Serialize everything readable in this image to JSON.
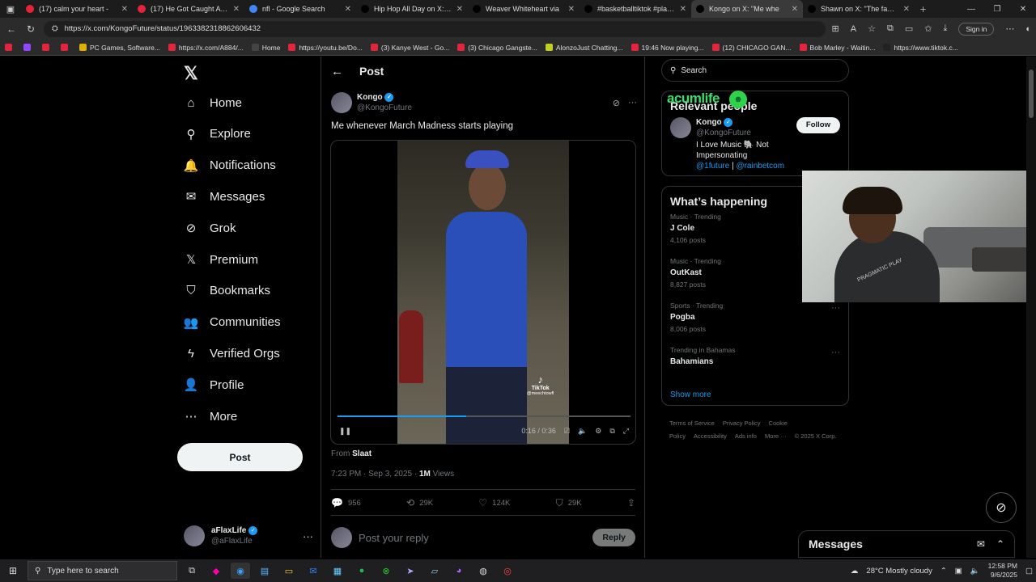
{
  "browser": {
    "tabs": [
      {
        "label": "(17) calm your heart -",
        "icon": "youtube-icon",
        "color": "#e5243b"
      },
      {
        "label": "(17) He Got Caught A 2ND",
        "icon": "youtube-icon",
        "color": "#e5243b"
      },
      {
        "label": "nfl - Google Search",
        "icon": "google-icon",
        "color": "#4285f4"
      },
      {
        "label": "Hip Hop All Day on X: \"You",
        "icon": "x-icon",
        "color": "#000000"
      },
      {
        "label": "Weaver Whiteheart via",
        "icon": "x-icon",
        "color": "#000000"
      },
      {
        "label": "#basketballtiktok #plaqueb",
        "icon": "tiktok-icon",
        "color": "#000000"
      },
      {
        "label": "Kongo on X: \"Me whe",
        "icon": "x-icon",
        "color": "#000000"
      },
      {
        "label": "Shawn on X: \"The fact nigg",
        "icon": "x-icon",
        "color": "#000000"
      }
    ],
    "url": "https://x.com/KongoFuture/status/1963382318862606432",
    "signin_label": "Sign in",
    "bookmarks": [
      {
        "label": "",
        "color": "#e5243b"
      },
      {
        "label": "",
        "color": "#9146ff"
      },
      {
        "label": "",
        "color": "#e5243b"
      },
      {
        "label": "",
        "color": "#e5243b"
      },
      {
        "label": "PC Games, Software...",
        "color": "#e0b000"
      },
      {
        "label": "https://x.com/A884/...",
        "color": "#e5243b"
      },
      {
        "label": "Home",
        "color": "#444444"
      },
      {
        "label": "https://youtu.be/Do...",
        "color": "#e5243b"
      },
      {
        "label": "(3) Kanye West - Go...",
        "color": "#e5243b"
      },
      {
        "label": "(3) Chicago Gangste...",
        "color": "#e5243b"
      },
      {
        "label": "AlonzoJust Chatting...",
        "color": "#c0d020"
      },
      {
        "label": "19:46 Now playing...",
        "color": "#e5243b"
      },
      {
        "label": "(12) CHICAGO GAN...",
        "color": "#e5243b"
      },
      {
        "label": "Bob Marley - Waitin...",
        "color": "#e5243b"
      },
      {
        "label": "https://www.tiktok.c...",
        "color": "#222222"
      }
    ]
  },
  "nav": {
    "items": [
      {
        "label": "Home",
        "icon": "home-icon",
        "glyph": "⌂"
      },
      {
        "label": "Explore",
        "icon": "search-icon",
        "glyph": "⚲"
      },
      {
        "label": "Notifications",
        "icon": "bell-icon",
        "glyph": "🔔"
      },
      {
        "label": "Messages",
        "icon": "envelope-icon",
        "glyph": "✉"
      },
      {
        "label": "Grok",
        "icon": "grok-icon",
        "glyph": "⊘"
      },
      {
        "label": "Premium",
        "icon": "x-icon",
        "glyph": "𝕏"
      },
      {
        "label": "Bookmarks",
        "icon": "bookmark-icon",
        "glyph": "⛉"
      },
      {
        "label": "Communities",
        "icon": "people-icon",
        "glyph": "👥"
      },
      {
        "label": "Verified Orgs",
        "icon": "lightning-icon",
        "glyph": "ϟ"
      },
      {
        "label": "Profile",
        "icon": "person-icon",
        "glyph": "👤"
      },
      {
        "label": "More",
        "icon": "more-circle-icon",
        "glyph": "⋯"
      }
    ],
    "post_label": "Post",
    "account": {
      "name": "aFlaxLife",
      "handle": "@aFlaxLife"
    }
  },
  "post": {
    "header": "Post",
    "author_name": "Kongo",
    "author_handle": "@KongoFuture",
    "text": "Me whenever March Madness starts playing",
    "video": {
      "tiktok_label": "TikTok",
      "tiktok_handle": "@meechtowfl",
      "time": "0:16 / 0:36",
      "progress": 0.44
    },
    "from_label": "From",
    "from_source": "Slaat",
    "timestamp": "7:23 PM · Sep 3, 2025 · ",
    "views": "1M",
    "views_label": " Views",
    "stats": {
      "replies": "956",
      "reposts": "29K",
      "likes": "124K",
      "bookmarks": "29K"
    },
    "reply_placeholder": "Post your reply",
    "reply_button": "Reply"
  },
  "sidebar": {
    "search_placeholder": "Search",
    "relevant_title": "Relevant people",
    "overlay_text": "acumlife",
    "person": {
      "name": "Kongo",
      "handle": "@KongoFuture",
      "bio": "I Love Music 🐘 Not Impersonating",
      "link1": "@1future",
      "sep": " | ",
      "link2": "@rainbetcom",
      "follow": "Follow"
    },
    "happening_title": "What’s happening",
    "trends": [
      {
        "category": "Music · Trending",
        "name": "J Cole",
        "count": "4,106 posts"
      },
      {
        "category": "Music · Trending",
        "name": "OutKast",
        "count": "8,827 posts"
      },
      {
        "category": "Sports · Trending",
        "name": "Pogba",
        "count": "8,006 posts"
      },
      {
        "category": "Trending in Bahamas",
        "name": "Bahamians",
        "count": ""
      }
    ],
    "show_more": "Show more",
    "footer": [
      "Terms of Service",
      "Privacy Policy",
      "Cookie Policy",
      "Accessibility",
      "Ads info",
      "More ···",
      "© 2025 X Corp."
    ]
  },
  "webcam": {
    "label": "PRAGMATIC PLAY"
  },
  "messages_dock": {
    "title": "Messages"
  },
  "taskbar": {
    "search_placeholder": "Type here to search",
    "weather": "28°C  Mostly cloudy",
    "time": "12:58 PM",
    "date": "9/6/2025"
  },
  "colors": {
    "accent": "#1d9bf0",
    "background": "#000000",
    "border": "#2f3336",
    "muted": "#71767b"
  }
}
